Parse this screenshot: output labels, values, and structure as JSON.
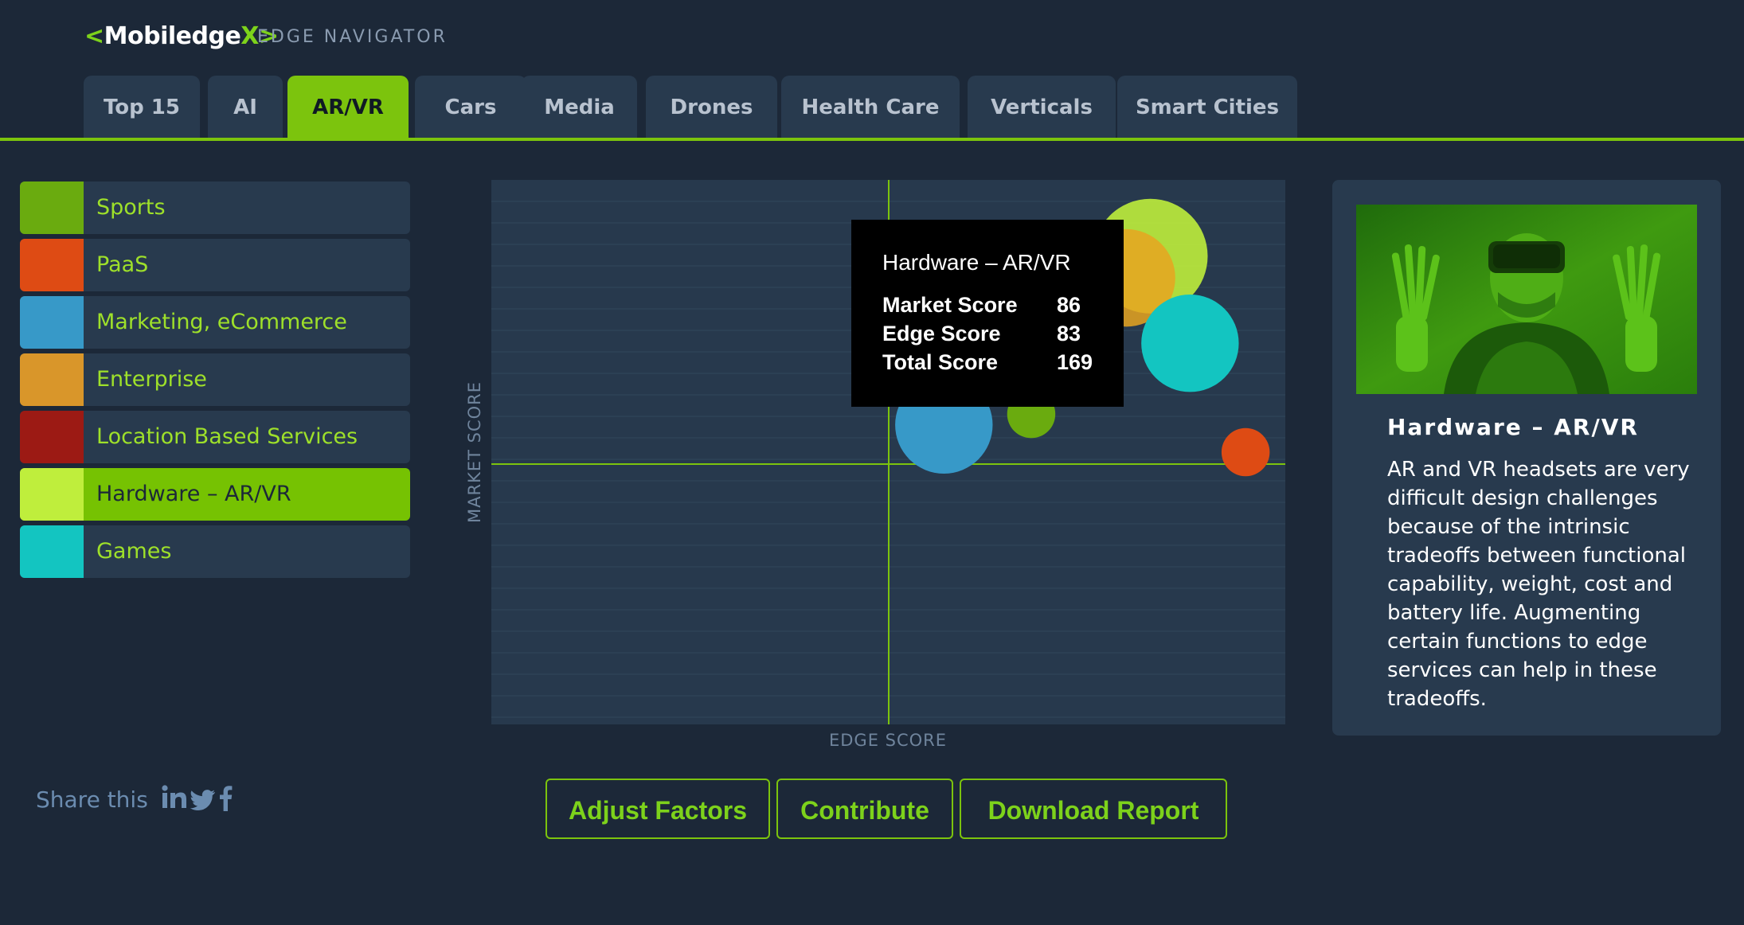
{
  "header": {
    "logo": {
      "left_bracket": "<",
      "name": "Mobiledge",
      "suffix": "X",
      "right_bracket": ">"
    },
    "subtitle": "EDGE NAVIGATOR"
  },
  "tabs": [
    {
      "label": "Top 15",
      "active": false
    },
    {
      "label": "AI",
      "active": false
    },
    {
      "label": "AR/VR",
      "active": true
    },
    {
      "label": "Cars",
      "active": false
    },
    {
      "label": "Media",
      "active": false
    },
    {
      "label": "Drones",
      "active": false
    },
    {
      "label": "Health Care",
      "active": false
    },
    {
      "label": "Verticals",
      "active": false
    },
    {
      "label": "Smart Cities",
      "active": false
    }
  ],
  "legend": [
    {
      "label": "Sports",
      "color": "#6aab0f"
    },
    {
      "label": "PaaS",
      "color": "#de4b14"
    },
    {
      "label": "Marketing, eCommerce",
      "color": "#3799c8"
    },
    {
      "label": "Enterprise",
      "color": "#d9962a"
    },
    {
      "label": "Location Based Services",
      "color": "#9c1a14"
    },
    {
      "label": "Hardware – AR/VR",
      "color": "#bfee3c",
      "active": true
    },
    {
      "label": "Games",
      "color": "#13c5c1"
    }
  ],
  "chart": {
    "xlabel": "EDGE SCORE",
    "ylabel": "MARKET SCORE",
    "tooltip": {
      "title": "Hardware – AR/VR",
      "rows": [
        {
          "label": "Market Score",
          "value": "86"
        },
        {
          "label": "Edge Score",
          "value": "83"
        },
        {
          "label": "Total Score",
          "value": "169"
        }
      ]
    }
  },
  "chart_data": {
    "type": "scatter",
    "xlabel": "EDGE SCORE",
    "ylabel": "MARKET SCORE",
    "xlim": [
      0,
      100
    ],
    "ylim": [
      0,
      100
    ],
    "grid": true,
    "series": [
      {
        "name": "Hardware – AR/VR",
        "x": 83,
        "y": 86,
        "size": 1.0,
        "color": "#bfee3c"
      },
      {
        "name": "Enterprise",
        "x": 80,
        "y": 82,
        "size": 0.85,
        "color": "#e8a520"
      },
      {
        "name": "Games",
        "x": 88,
        "y": 70,
        "size": 0.85,
        "color": "#13c5c1"
      },
      {
        "name": "Location Based Services",
        "x": 69,
        "y": 69,
        "size": 0.3,
        "color": "#9c1a14"
      },
      {
        "name": "Marketing, eCommerce",
        "x": 57,
        "y": 55,
        "size": 0.85,
        "color": "#3799c8"
      },
      {
        "name": "Sports",
        "x": 68,
        "y": 57,
        "size": 0.42,
        "color": "#6aab0f"
      },
      {
        "name": "PaaS",
        "x": 95,
        "y": 50,
        "size": 0.42,
        "color": "#de4b14"
      }
    ]
  },
  "info": {
    "title": "Hardware – AR/VR",
    "text": "AR and VR headsets are very difficult design challenges because of the intrinsic tradeoffs between functional capability, weight, cost and battery life. Augmenting certain functions to edge services can help in these tradeoffs."
  },
  "share": {
    "label": "Share this",
    "icons": [
      "linkedin-icon",
      "twitter-icon",
      "facebook-icon"
    ]
  },
  "actions": [
    {
      "label": "Adjust Factors"
    },
    {
      "label": "Contribute"
    },
    {
      "label": "Download Report"
    }
  ],
  "colors": {
    "accent": "#7cc40d",
    "background": "#1c2838",
    "panel": "#283a4e"
  }
}
